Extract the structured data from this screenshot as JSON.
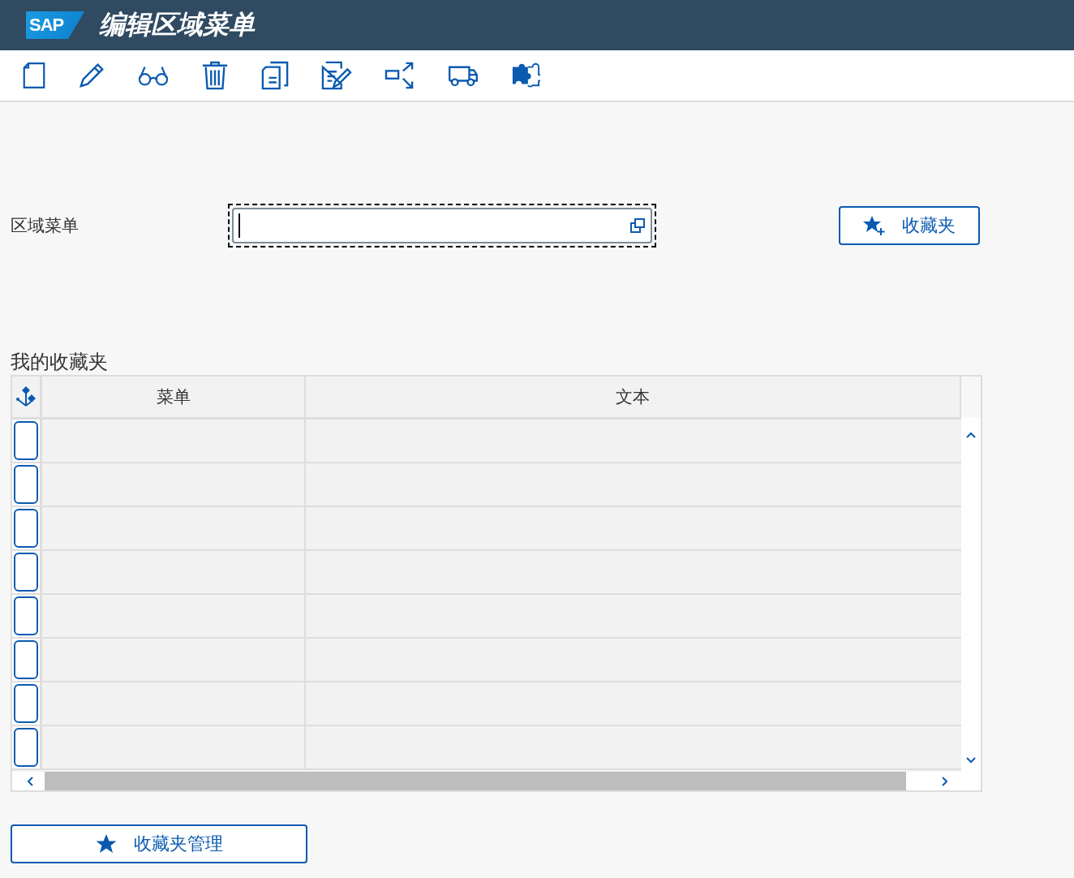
{
  "header": {
    "logo": "SAP",
    "title": "编辑区域菜单"
  },
  "form": {
    "label": "区域菜单",
    "field": {
      "focused": true
    },
    "favorites_button": "收藏夹"
  },
  "favorites": {
    "title": "我的收藏夹",
    "columns": [
      "菜单",
      "文本"
    ],
    "rows": [
      {
        "selected": false
      },
      {
        "selected": false
      },
      {
        "selected": false
      },
      {
        "selected": false
      },
      {
        "selected": false
      },
      {
        "selected": false
      },
      {
        "selected": false
      },
      {
        "selected": false
      }
    ]
  },
  "manage_button": "收藏夹管理"
}
